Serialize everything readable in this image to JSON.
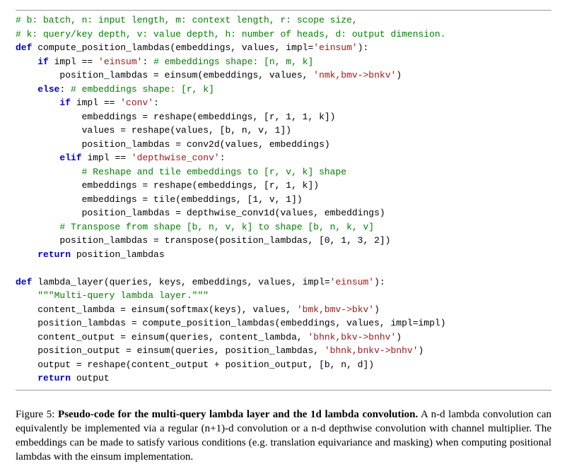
{
  "code": {
    "c1a": "# b: batch, n: input length, m: context length, r: scope size,",
    "c1b": "# k: query/key depth, v: value depth, h: number of heads, d: output dimension.",
    "def1": "def",
    "fn1": "compute_position_lambdas(embeddings, values, impl=",
    "s_einsum": "'einsum'",
    "close_paren": "):",
    "if1": "if",
    "impl_eq": " impl == ",
    "colon": ":",
    "c2": " # embeddings shape: [n, m, k]",
    "pl_einsum": "        position_lambdas = einsum(embeddings, values, ",
    "s_nmk": "'nmk,bmv->bnkv'",
    "rparen": ")",
    "else1": "else",
    "c3": " # embeddings shape: [r, k]",
    "if2": "if",
    "s_conv": "'conv'",
    "l_emb_resh": "            embeddings = reshape(embeddings, [r, 1, 1, k])",
    "l_val_resh": "            values = reshape(values, [b, n, v, 1])",
    "l_pl_conv2d": "            position_lambdas = conv2d(values, embeddings)",
    "elif1": "elif",
    "s_dwconv": "'depthwise_conv'",
    "c4": "            # Reshape and tile embeddings to [r, v, k] shape",
    "l_emb_resh2": "            embeddings = reshape(embeddings, [r, 1, k])",
    "l_emb_tile": "            embeddings = tile(embeddings, [1, v, 1])",
    "l_pl_dw": "            position_lambdas = depthwise_conv1d(values, embeddings)",
    "c5": "        # Transpose from shape [b, n, v, k] to shape [b, n, k, v]",
    "l_transpose": "        position_lambdas = transpose(position_lambdas, [0, 1, 3, 2])",
    "return1": "return",
    "ret_pl": " position_lambdas",
    "def2": "def",
    "fn2": "lambda_layer(queries, keys, embeddings, values, impl=",
    "docstr": "    \"\"\"Multi-query lambda layer.\"\"\"",
    "l_cl": "    content_lambda = einsum(softmax(keys), values, ",
    "s_bmk": "'bmk,bmv->bkv'",
    "l_pl_call": "    position_lambdas = compute_position_lambdas(embeddings, values, impl=impl)",
    "l_co": "    content_output = einsum(queries, content_lambda, ",
    "s_bhnk1": "'bhnk,bkv->bnhv'",
    "l_po": "    position_output = einsum(queries, position_lambdas, ",
    "s_bhnk2": "'bhnk,bnkv->bnhv'",
    "l_out": "    output = reshape(content_output + position_output, [b, n, d])",
    "ret_out": " output"
  },
  "caption": {
    "label": "Figure 5: ",
    "title": "Pseudo-code for the multi-query lambda layer and the 1d lambda convolution.",
    "body": " A n-d lambda convolution can equivalently be implemented via a regular (n+1)-d convolution or a n-d depthwise convolution with channel multiplier. The embeddings can be made to satisfy various conditions (e.g. translation equivariance and masking) when computing positional lambdas with the einsum implementation."
  }
}
